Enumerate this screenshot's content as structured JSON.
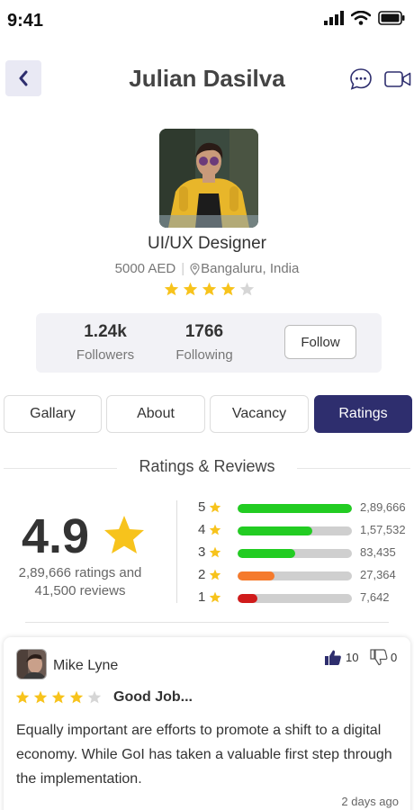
{
  "status_bar": {
    "time": "9:41"
  },
  "header": {
    "title": "Julian Dasilva"
  },
  "profile": {
    "role": "UI/UX Designer",
    "rate": "5000 AED",
    "location": "Bangaluru, India",
    "rating_stars": 4
  },
  "stats": {
    "followers_value": "1.24k",
    "followers_label": "Followers",
    "following_value": "1766",
    "following_label": "Following",
    "follow_label": "Follow"
  },
  "tabs": [
    {
      "label": "Gallary",
      "active": false
    },
    {
      "label": "About",
      "active": false
    },
    {
      "label": "Vacancy",
      "active": false
    },
    {
      "label": "Ratings",
      "active": true
    }
  ],
  "ratings": {
    "section_title": "Ratings & Reviews",
    "average": "4.9",
    "summary_line1": "2,89,666 ratings and",
    "summary_line2": "41,500 reviews",
    "distribution": [
      {
        "stars": "5",
        "count": "2,89,666",
        "fraction": 1.0,
        "color": "#22cc22"
      },
      {
        "stars": "4",
        "count": "1,57,532",
        "fraction": 0.65,
        "color": "#22cc22"
      },
      {
        "stars": "3",
        "count": "83,435",
        "fraction": 0.5,
        "color": "#22cc22"
      },
      {
        "stars": "2",
        "count": "27,364",
        "fraction": 0.32,
        "color": "#f57a2c"
      },
      {
        "stars": "1",
        "count": "7,642",
        "fraction": 0.17,
        "color": "#d01b1b"
      }
    ]
  },
  "review": {
    "name": "Mike Lyne",
    "likes": "10",
    "dislikes": "0",
    "stars": 4,
    "title": "Good Job...",
    "body": "Equally important are efforts to promote a shift to a digital economy. While GoI has taken a valuable first step through the implementation.",
    "time": "2 days ago"
  },
  "colors": {
    "accent": "#2e2e6e",
    "star_filled": "#f7c31c",
    "star_empty": "#d6d6d6"
  }
}
